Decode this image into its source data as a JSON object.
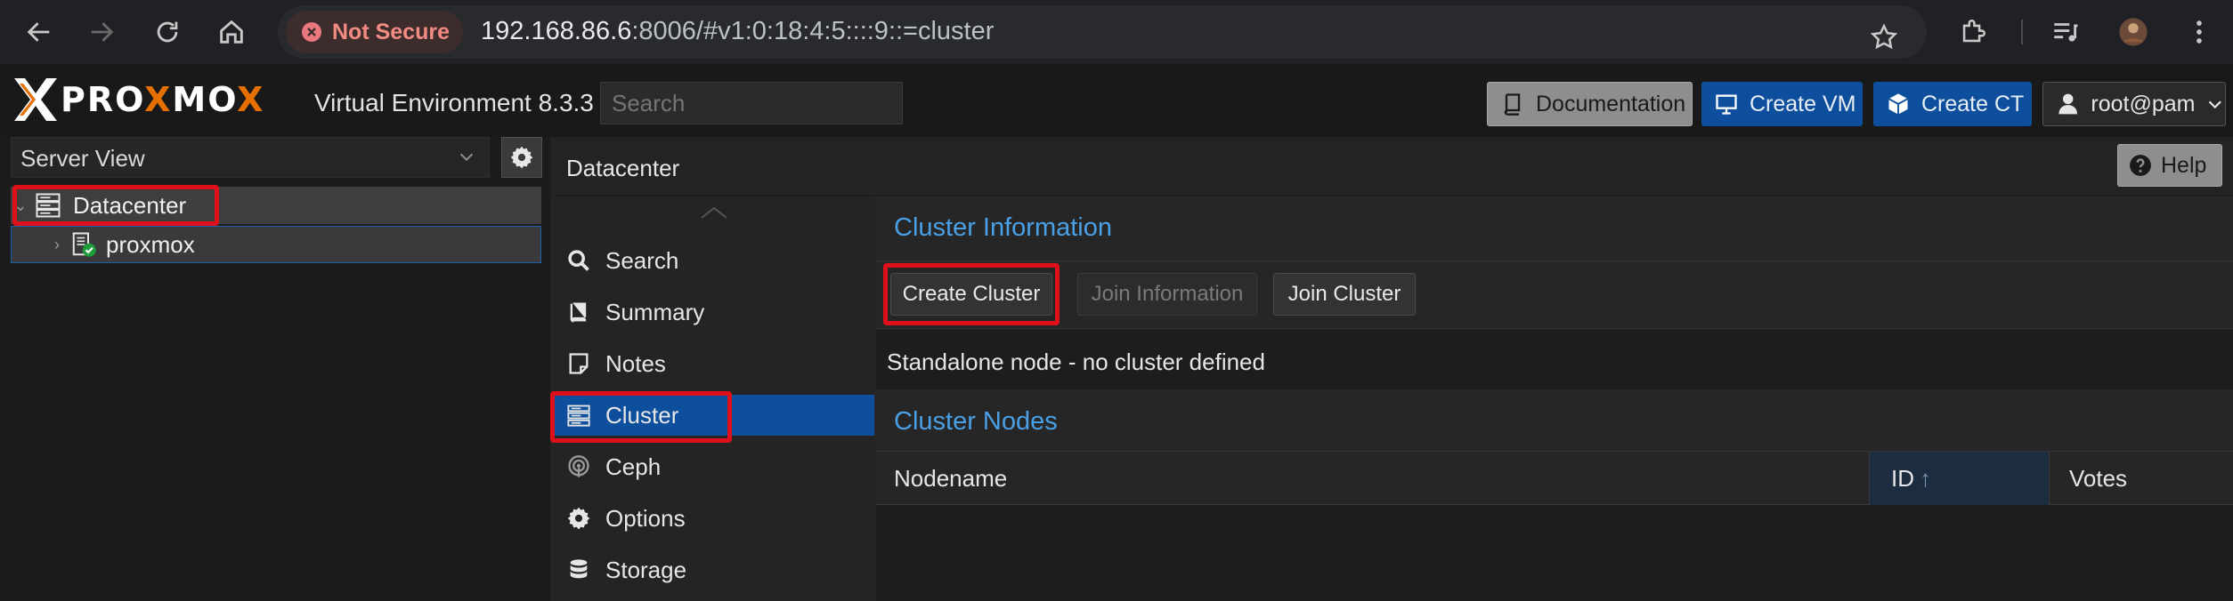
{
  "browser": {
    "security_label": "Not Secure",
    "url_host": "192.168.86.6",
    "url_rest": ":8006/#v1:0:18:4:5::::9::=cluster"
  },
  "header": {
    "logo_left": "PRO",
    "logo_x": "X",
    "logo_mid": "MO",
    "version": "Virtual Environment 8.3.3",
    "search_placeholder": "Search",
    "documentation_label": "Documentation",
    "create_vm_label": "Create VM",
    "create_ct_label": "Create CT",
    "user_label": "root@pam"
  },
  "tree": {
    "view_label": "Server View",
    "items": [
      {
        "label": "Datacenter",
        "icon": "server-rack-icon"
      },
      {
        "label": "proxmox",
        "icon": "node-online-icon"
      }
    ]
  },
  "content": {
    "breadcrumb": "Datacenter",
    "help_label": "Help",
    "menu": [
      {
        "label": "Search",
        "icon": "search-icon"
      },
      {
        "label": "Summary",
        "icon": "book-icon"
      },
      {
        "label": "Notes",
        "icon": "note-icon"
      },
      {
        "label": "Cluster",
        "icon": "server-rack-icon",
        "active": true
      },
      {
        "label": "Ceph",
        "icon": "ceph-icon"
      },
      {
        "label": "Options",
        "icon": "gear-icon"
      },
      {
        "label": "Storage",
        "icon": "database-icon"
      }
    ]
  },
  "cluster": {
    "info_title": "Cluster Information",
    "create_cluster_label": "Create Cluster",
    "join_information_label": "Join Information",
    "join_cluster_label": "Join Cluster",
    "status_text": "Standalone node - no cluster defined",
    "nodes_title": "Cluster Nodes",
    "columns": {
      "nodename": "Nodename",
      "id": "ID",
      "votes": "Votes"
    }
  },
  "colors": {
    "accent": "#0d4f9c",
    "section_title": "#4aa0e6",
    "highlight": "#e0101a"
  }
}
